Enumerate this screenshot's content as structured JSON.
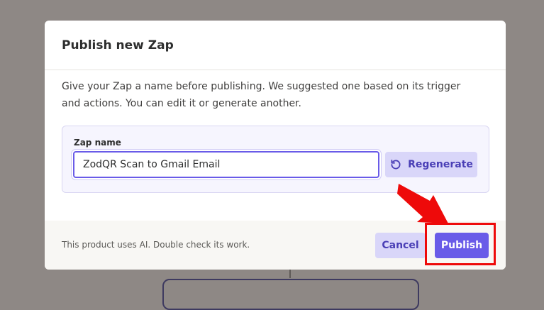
{
  "modal": {
    "title": "Publish new Zap",
    "description": "Give your Zap a name before publishing. We suggested one based on its trigger and actions. You can edit it or generate another.",
    "name_field": {
      "label": "Zap name",
      "value": "ZodQR Scan to Gmail Email"
    },
    "regenerate_label": "Regenerate",
    "footer_note": "This product uses AI. Double check its work.",
    "cancel_label": "Cancel",
    "publish_label": "Publish"
  },
  "icons": {
    "regenerate": "rotate-ccw-icon",
    "annotation": "red-arrow-icon"
  },
  "colors": {
    "accent": "#695be8",
    "accent_soft": "#d9d6f9",
    "accent_text": "#4a3fb6",
    "annotation": "#ee0a0a",
    "overlay": "#8e8885"
  }
}
